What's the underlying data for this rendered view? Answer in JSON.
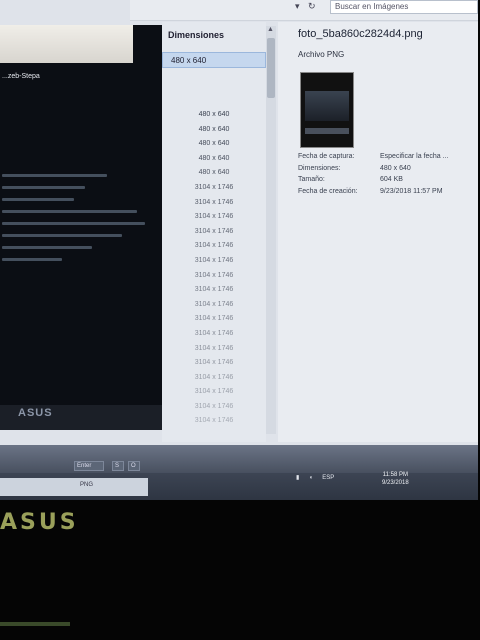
{
  "search": {
    "placeholder": "Buscar en Imágenes"
  },
  "toolbar": {
    "icons": [
      "dropdown-arrow-icon",
      "refresh-icon"
    ]
  },
  "viewer": {
    "file_label": "...zeb-Stepa",
    "logo": "ASUS"
  },
  "columns": {
    "dimensions_header": "Dimensiones",
    "selected_value": "480 x 640",
    "values": [
      "480 x 640",
      "480 x 640",
      "480 x 640",
      "480 x 640",
      "480 x 640",
      "3104 x 1746",
      "3104 x 1746",
      "3104 x 1746",
      "3104 x 1746",
      "3104 x 1746",
      "3104 x 1746",
      "3104 x 1746",
      "3104 x 1746",
      "3104 x 1746",
      "3104 x 1746",
      "3104 x 1746",
      "3104 x 1746",
      "3104 x 1746",
      "3104 x 1746",
      "3104 x 1746",
      "3104 x 1746",
      "3104 x 1746"
    ]
  },
  "details": {
    "file_name": "foto_5ba860c2824d4.png",
    "file_type": "Archivo PNG",
    "properties": [
      {
        "label": "Fecha de captura:",
        "value": "Especificar la fecha ..."
      },
      {
        "label": "Dimensiones:",
        "value": "480 x 640"
      },
      {
        "label": "Tamaño:",
        "value": "604 KB"
      },
      {
        "label": "Fecha de creación:",
        "value": "9/23/2018 11:57 PM"
      }
    ]
  },
  "taskbar": {
    "buttons": [
      "Enter",
      "S",
      "O"
    ],
    "tab_label": "PNG",
    "tray_items": [
      "ESP"
    ],
    "clock_time": "11:58 PM",
    "clock_date": "9/23/2018"
  },
  "bezel": {
    "logo": "ASUS"
  }
}
